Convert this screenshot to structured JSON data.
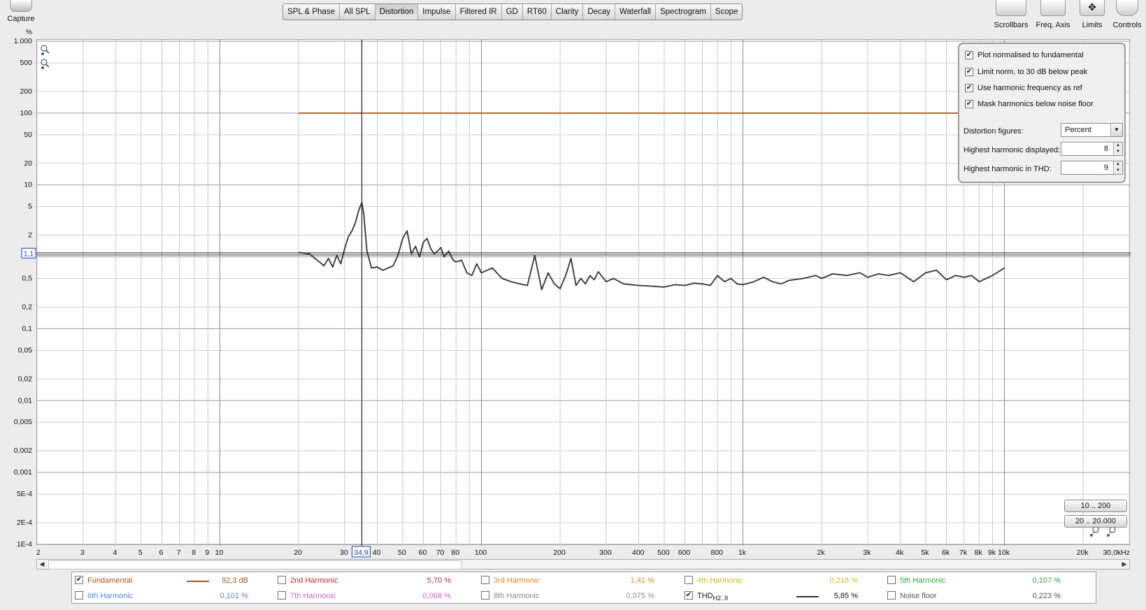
{
  "toolbar": {
    "capture_label": "Capture",
    "tabs": [
      "SPL & Phase",
      "All SPL",
      "Distortion",
      "Impulse",
      "Filtered IR",
      "GD",
      "RT60",
      "Clarity",
      "Decay",
      "Waterfall",
      "Spectrogram",
      "Scope"
    ],
    "active_tab": "Distortion",
    "right_buttons": [
      "Scrollbars",
      "Freq. Axis",
      "Limits",
      "Controls"
    ]
  },
  "chart_data": {
    "type": "line",
    "ylabel": "%",
    "yscale": "log",
    "ylim": [
      0.0001,
      1000
    ],
    "xscale": "log",
    "xlim": [
      2,
      30000
    ],
    "y_ticks": [
      "1.000",
      "500",
      "200",
      "100",
      "50",
      "20",
      "10",
      "5",
      "2",
      "1",
      "0,5",
      "0,2",
      "0,1",
      "0,05",
      "0,02",
      "0,01",
      "0,005",
      "0,002",
      "0,001",
      "5E-4",
      "2E-4",
      "1E-4"
    ],
    "x_ticks": [
      "2",
      "3",
      "4",
      "5",
      "6",
      "7",
      "8",
      "9",
      "10",
      "20",
      "30",
      "40",
      "50",
      "60",
      "70",
      "80",
      "100",
      "200",
      "300",
      "400",
      "500",
      "600",
      "800",
      "1k",
      "2k",
      "3k",
      "4k",
      "5k",
      "6k",
      "7k",
      "8k",
      "9k",
      "10k",
      "20k",
      "30,0kHz"
    ],
    "cursor": {
      "x_label": "34,9",
      "y_label": "1,1",
      "x": 34.9,
      "y": 1.1
    },
    "series": [
      {
        "name": "Fundamental",
        "color": "#b45014",
        "x": [
          20,
          10000
        ],
        "y": [
          100,
          100
        ]
      },
      {
        "name": "THD H2..9",
        "color": "#333333",
        "x": [
          20,
          22,
          24,
          25,
          26,
          27,
          28,
          29,
          30,
          31,
          32,
          33,
          34,
          34.9,
          35.5,
          36.5,
          38,
          40,
          42,
          44,
          46,
          48,
          50,
          52,
          54,
          56,
          58,
          60,
          62,
          64,
          66,
          68,
          70,
          72,
          75,
          78,
          80,
          84,
          88,
          92,
          96,
          100,
          110,
          120,
          130,
          140,
          150,
          160,
          170,
          180,
          190,
          200,
          210,
          220,
          230,
          240,
          250,
          260,
          270,
          280,
          300,
          320,
          350,
          400,
          450,
          500,
          550,
          600,
          650,
          700,
          750,
          800,
          850,
          900,
          950,
          1000,
          1100,
          1200,
          1300,
          1400,
          1500,
          1700,
          1900,
          2000,
          2200,
          2500,
          2800,
          3000,
          3300,
          3600,
          4000,
          4500,
          5000,
          5500,
          6000,
          6500,
          7000,
          7500,
          8000,
          9000,
          10000
        ],
        "y": [
          1.15,
          1.1,
          0.85,
          0.75,
          0.95,
          0.72,
          1.05,
          0.8,
          1.3,
          1.9,
          2.3,
          3.0,
          4.5,
          5.7,
          4.0,
          1.2,
          0.7,
          0.72,
          0.65,
          0.7,
          0.75,
          1.05,
          1.8,
          2.3,
          1.1,
          1.4,
          1.0,
          1.6,
          1.8,
          1.3,
          1.1,
          1.2,
          1.35,
          1.0,
          1.2,
          0.9,
          0.85,
          0.9,
          0.6,
          0.55,
          0.8,
          0.6,
          0.7,
          0.5,
          0.45,
          0.42,
          0.4,
          1.05,
          0.35,
          0.6,
          0.42,
          0.36,
          0.55,
          0.95,
          0.4,
          0.5,
          0.42,
          0.55,
          0.48,
          0.62,
          0.45,
          0.5,
          0.42,
          0.4,
          0.39,
          0.38,
          0.41,
          0.4,
          0.43,
          0.42,
          0.4,
          0.55,
          0.45,
          0.5,
          0.42,
          0.41,
          0.45,
          0.52,
          0.45,
          0.42,
          0.47,
          0.5,
          0.55,
          0.5,
          0.58,
          0.55,
          0.6,
          0.52,
          0.58,
          0.55,
          0.6,
          0.45,
          0.6,
          0.65,
          0.48,
          0.55,
          0.52,
          0.55,
          0.45,
          0.55,
          0.7
        ]
      }
    ]
  },
  "controls": {
    "checkboxes": [
      {
        "label": "Plot normalised to fundamental",
        "checked": true
      },
      {
        "label": "Limit norm. to 30 dB below peak",
        "checked": true
      },
      {
        "label": "Use harmonic frequency as ref",
        "checked": true
      },
      {
        "label": "Mask harmonics below noise floor",
        "checked": true
      }
    ],
    "distortion_figures_label": "Distortion figures:",
    "distortion_figures_value": "Percent",
    "highest_displayed_label": "Highest harmonic displayed:",
    "highest_displayed_value": "8",
    "highest_thd_label": "Highest harmonic in THD:",
    "highest_thd_value": "9"
  },
  "range_buttons": [
    "10 .. 200",
    "20 .. 20.000"
  ],
  "legend": [
    {
      "label": "Fundamental",
      "value": "92,3 dB",
      "checked": true,
      "color": "#b45014",
      "swatch": true
    },
    {
      "label": "2nd Harmonic",
      "value": "5,70 %",
      "checked": false,
      "color": "#c0262c",
      "swatch": false
    },
    {
      "label": "3rd Harmonic",
      "value": "1,41 %",
      "checked": false,
      "color": "#e08a14",
      "swatch": false
    },
    {
      "label": "4th Harmonic",
      "value": "0,218 %",
      "checked": false,
      "color": "#c8c014",
      "swatch": false
    },
    {
      "label": "5th Harmonic",
      "value": "0,107 %",
      "checked": false,
      "color": "#2ea832",
      "swatch": false
    },
    {
      "label": "6th Harmonic",
      "value": "0,101 %",
      "checked": false,
      "color": "#4a8ae0",
      "swatch": false
    },
    {
      "label": "7th Harmonic",
      "value": "0,068 %",
      "checked": false,
      "color": "#d060d0",
      "swatch": false
    },
    {
      "label": "8th Harmonic",
      "value": "0,075 %",
      "checked": false,
      "color": "#8a8a8a",
      "swatch": false
    },
    {
      "label": "THD",
      "sub": "H2..9",
      "value": "5,85 %",
      "checked": true,
      "color": "#333333",
      "swatch": true
    },
    {
      "label": "Noise floor",
      "value": "0,223 %",
      "checked": false,
      "color": "#555555",
      "swatch": false
    }
  ]
}
